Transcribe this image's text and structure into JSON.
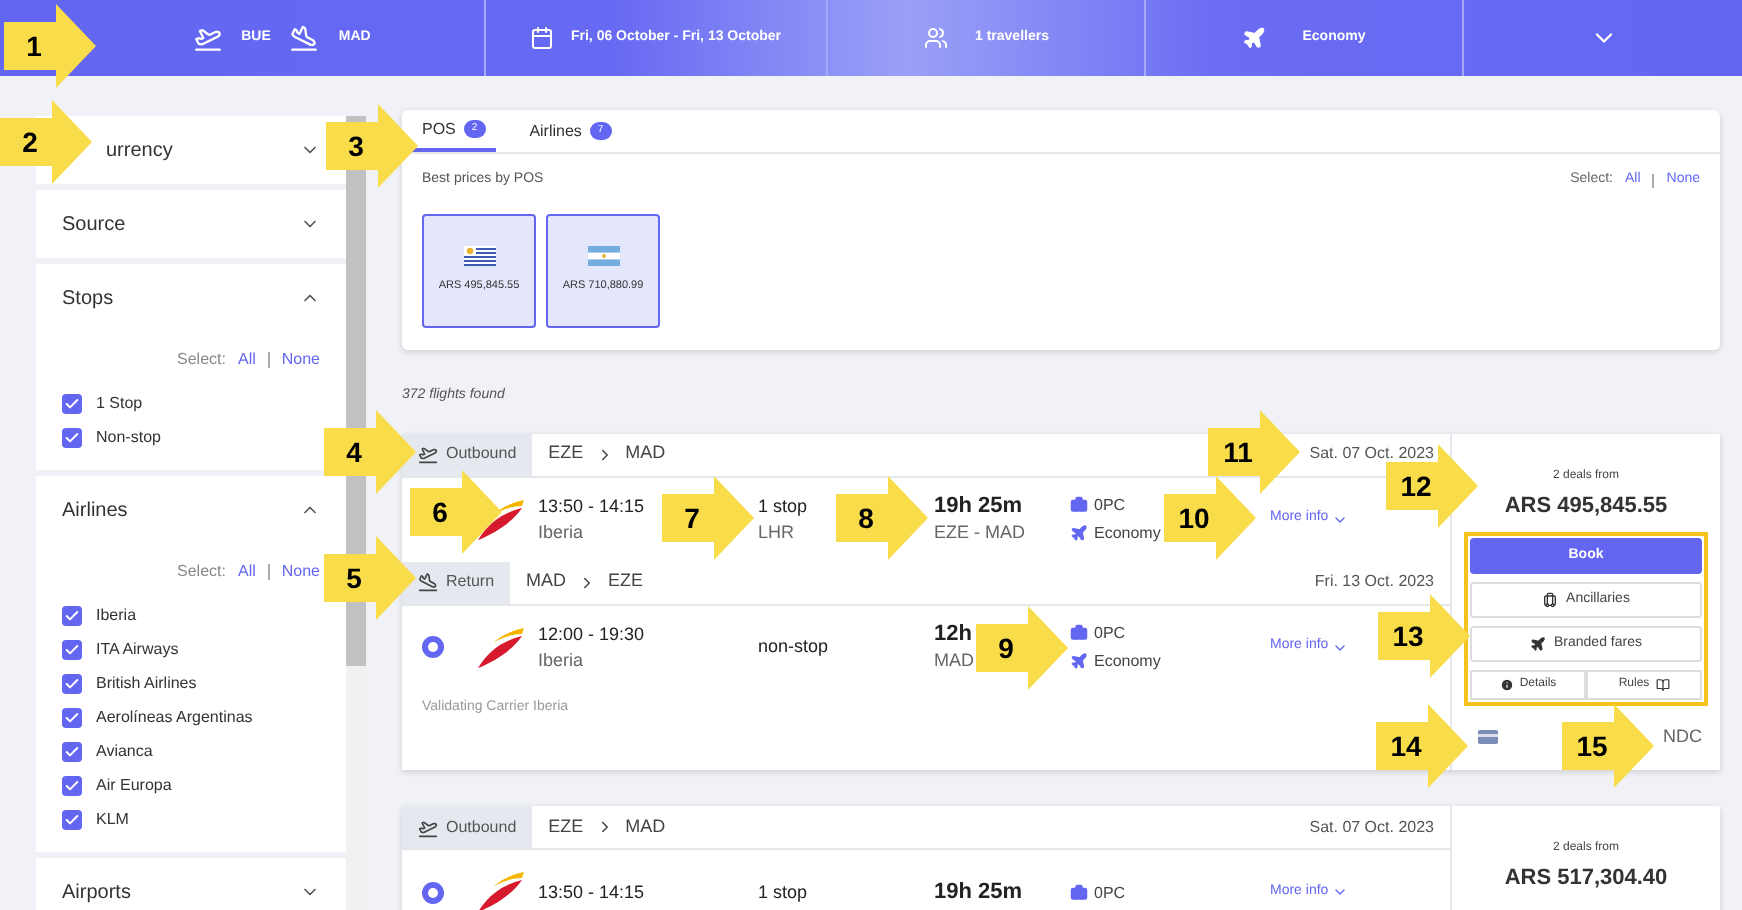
{
  "header": {
    "origin": "BUE",
    "destination": "MAD",
    "dates": "Fri, 06 October - Fri, 13 October",
    "travellers": "1 travellers",
    "cabin": "Economy"
  },
  "sidebar": {
    "sections": [
      {
        "title": "urrency",
        "expanded": false
      },
      {
        "title": "Source",
        "expanded": false
      },
      {
        "title": "Stops",
        "expanded": true,
        "select_label": "Select:",
        "all": "All",
        "none": "None",
        "options": [
          {
            "label": "1 Stop",
            "checked": true
          },
          {
            "label": "Non-stop",
            "checked": true
          }
        ]
      },
      {
        "title": "Airlines",
        "expanded": true,
        "select_label": "Select:",
        "all": "All",
        "none": "None",
        "options": [
          {
            "label": "Iberia",
            "checked": true
          },
          {
            "label": "ITA Airways",
            "checked": true
          },
          {
            "label": "British Airlines",
            "checked": true
          },
          {
            "label": "Aerolíneas Argentinas",
            "checked": true
          },
          {
            "label": "Avianca",
            "checked": true
          },
          {
            "label": "Air Europa",
            "checked": true
          },
          {
            "label": "KLM",
            "checked": true
          }
        ]
      },
      {
        "title": "Airports",
        "expanded": false
      }
    ]
  },
  "tabs": [
    {
      "label": "POS",
      "count": "2",
      "selected": true
    },
    {
      "label": "Airlines",
      "count": "7",
      "selected": false
    }
  ],
  "pos_panel": {
    "subtitle": "Best prices by POS",
    "select_label": "Select:",
    "all": "All",
    "none": "None",
    "cards": [
      {
        "kind": "uruguay",
        "price": "ARS 495,845.55",
        "selected": true
      },
      {
        "kind": "argentina",
        "price": "ARS 710,880.99",
        "selected": true
      }
    ]
  },
  "results_count": "372 flights found",
  "results": [
    {
      "legs": [
        {
          "kind": "outbound",
          "label": "Outbound",
          "from": "EZE",
          "to": "MAD",
          "date": "Sat. 07 Oct. 2023",
          "flights": [
            {
              "times": "13:50 - 14:15",
              "airline": "Iberia",
              "stops": "1 stop",
              "via": "LHR",
              "duration": "19h 25m",
              "route": "EZE - MAD",
              "baggage": "0PC",
              "cabin": "Economy",
              "more": "More info"
            }
          ]
        },
        {
          "kind": "return",
          "label": "Return",
          "from": "MAD",
          "to": "EZE",
          "date": "Fri. 13 Oct. 2023",
          "flights": [
            {
              "selected": true,
              "times": "12:00 - 19:30",
              "airline": "Iberia",
              "stops": "non-stop",
              "duration": "12h",
              "route": "MAD",
              "baggage": "0PC",
              "cabin": "Economy",
              "more": "More info"
            }
          ]
        }
      ],
      "validating": "Validating Carrier Iberia",
      "deals": "2 deals from",
      "price": "ARS 495,845.55",
      "book": "Book",
      "ancillaries": "Ancillaries",
      "branded": "Branded fares",
      "details": "Details",
      "rules": "Rules",
      "source": "NDC"
    },
    {
      "legs": [
        {
          "kind": "outbound",
          "label": "Outbound",
          "from": "EZE",
          "to": "MAD",
          "date": "Sat. 07 Oct. 2023",
          "flights": [
            {
              "selected": true,
              "times": "13:50 - 14:15",
              "stops": "1 stop",
              "duration": "19h 25m",
              "baggage": "0PC",
              "more": "More info"
            }
          ]
        }
      ],
      "deals": "2 deals from",
      "price": "ARS 517,304.40"
    }
  ],
  "callouts": [
    "1",
    "2",
    "3",
    "4",
    "5",
    "6",
    "7",
    "8",
    "9",
    "10",
    "11",
    "12",
    "13",
    "14",
    "15"
  ]
}
